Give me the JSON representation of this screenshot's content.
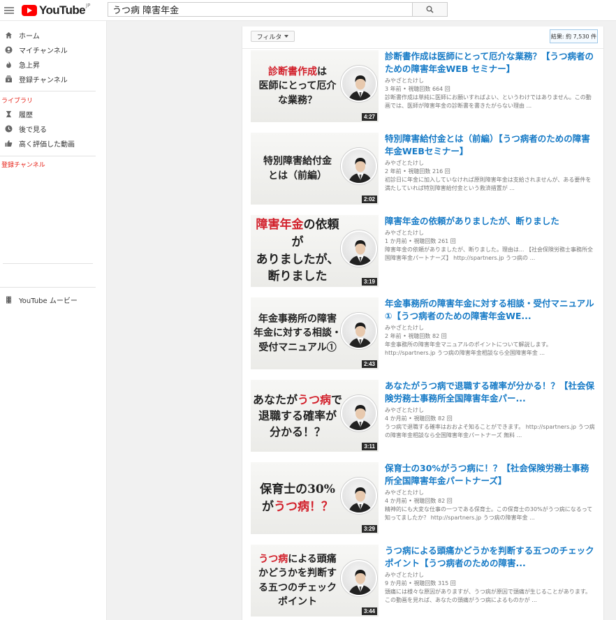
{
  "header": {
    "logo_text": "YouTube",
    "logo_region": "JP",
    "search_value": "うつ病 障害年金",
    "search_icon": "search-icon"
  },
  "sidebar": {
    "items": [
      {
        "label": "ホーム",
        "icon": "home-icon"
      },
      {
        "label": "マイチャンネル",
        "icon": "account-icon"
      },
      {
        "label": "急上昇",
        "icon": "flame-icon"
      },
      {
        "label": "登録チャンネル",
        "icon": "subscriptions-icon"
      }
    ],
    "library_title": "ライブラリ",
    "library_items": [
      {
        "label": "履歴",
        "icon": "history-icon"
      },
      {
        "label": "後で見る",
        "icon": "clock-icon"
      },
      {
        "label": "高く評価した動画",
        "icon": "thumbs-up-icon"
      }
    ],
    "subscriptions_title": "登録チャンネル",
    "movies_label": "YouTube ムービー",
    "movies_icon": "film-icon"
  },
  "results": {
    "filter_label": "フィルタ",
    "count_label": "結果: 約 7,530 件",
    "videos": [
      {
        "title": "診断書作成は医師にとって厄介な業務？【うつ病者のための障害年金WEB セミナー】",
        "channel": "みやざとたけし",
        "meta": "3 年前 • 視聴回数 664 回",
        "description": "診断書作成は単純に医師にお願いすればよい、というわけではありません。この動画では、医師が障害年金の診断書を書きたがらない理由 ...",
        "duration": "4:27",
        "thumb_lines": [
          [
            "診断書作成",
            "は"
          ],
          [
            "医師にとって厄介"
          ],
          [
            "な業務？"
          ]
        ],
        "thumb_size": 14
      },
      {
        "title": "特別障害給付金とは（前編）【うつ病者のための障害年金WEBセミナー】",
        "channel": "みやざとたけし",
        "meta": "2 年前 • 視聴回数 216 回",
        "description": "初診日に年金に加入していなければ原則障害年金は支給されませんが、ある要件を満たしていれば特別障害給付金という救済措置が ...",
        "duration": "2:02",
        "thumb_lines": [
          [
            "特別障害給付金"
          ],
          [
            "とは（前編）"
          ]
        ],
        "thumb_size": 14
      },
      {
        "title": "障害年金の依頼がありましたが、断りました",
        "channel": "みやざとたけし",
        "meta": "1 か月前 • 視聴回数 261 回",
        "description": "障害年金の依頼がありましたが、断りました。理由は... 【社会保険労務士事務所全国障害年金パートナーズ】 http://spartners.jp うつ病の ...",
        "duration": "3:19",
        "thumb_lines": [
          [
            "障害年金",
            "の依頼が"
          ],
          [
            "ありましたが、"
          ],
          [
            "断りました"
          ]
        ],
        "thumb_size": 17
      },
      {
        "title": "年金事務所の障害年金に対する相談・受付マニュアル①【うつ病者のための障害年金WE...",
        "channel": "みやざとたけし",
        "meta": "2 年前 • 視聴回数 82 回",
        "description": "年金事務所の障害年金マニュアルのポイントについて解説します。 http://spartners.jp うつ病の障害年金相談なら全国障害年金 ...",
        "duration": "2:43",
        "thumb_lines": [
          [
            "年金事務所の障害"
          ],
          [
            "年金に対する相談・"
          ],
          [
            "受付マニュアル①"
          ]
        ],
        "thumb_size": 14
      },
      {
        "title": "あなたがうつ病で退職する確率が分かる！？【社会保険労務士事務所全国障害年金パー...",
        "channel": "みやざとたけし",
        "meta": "4 か月前 • 視聴回数 82 回",
        "description": "うつ病で退職する確率はおおよそ知ることができます。 http://spartners.jp うつ病の障害年金相談なら全国障害年金パートナーズ 無料 ...",
        "duration": "3:11",
        "thumb_lines": [
          [
            "あなたが",
            "うつ病",
            "で"
          ],
          [
            "退職する確率が"
          ],
          [
            "分かる！？"
          ]
        ],
        "thumb_size": 16
      },
      {
        "title": "保育士の30%がうつ病に！？【社会保険労務士事務所全国障害年金パートナーズ】",
        "channel": "みやざとたけし",
        "meta": "4 か月前 • 視聴回数 82 回",
        "description": "精神的にも大変な仕事の一つである保育士。この保育士の30%がうつ病になるって知ってましたか？ http://spartners.jp うつ病の障害年金 ...",
        "duration": "3:29",
        "thumb_lines": [
          [
            "保育士の30%"
          ],
          [
            "が",
            "うつ病！？"
          ]
        ],
        "thumb_size": 17
      },
      {
        "title": "うつ病による頭痛かどうかを判断する五つのチェックポイント【うつ病者のための障害...",
        "channel": "みやざとたけし",
        "meta": "9 か月前 • 視聴回数 315 回",
        "description": "頭痛には様々な原因がありますが、うつ病が原因で頭痛が生じることがあります。この動画を見れば、あなたの頭痛がうつ病によるものかが ...",
        "duration": "3:44",
        "thumb_lines": [
          [
            "うつ病",
            "による頭痛"
          ],
          [
            "かどうかを判断す"
          ],
          [
            "る五つのチェック"
          ],
          [
            "ポイント"
          ]
        ],
        "thumb_size": 14
      }
    ]
  },
  "colors": {
    "youtube_red": "#ff0000",
    "link_blue": "#167ac6",
    "section_red": "#e62117",
    "thumb_highlight_red": "#d2202b"
  }
}
